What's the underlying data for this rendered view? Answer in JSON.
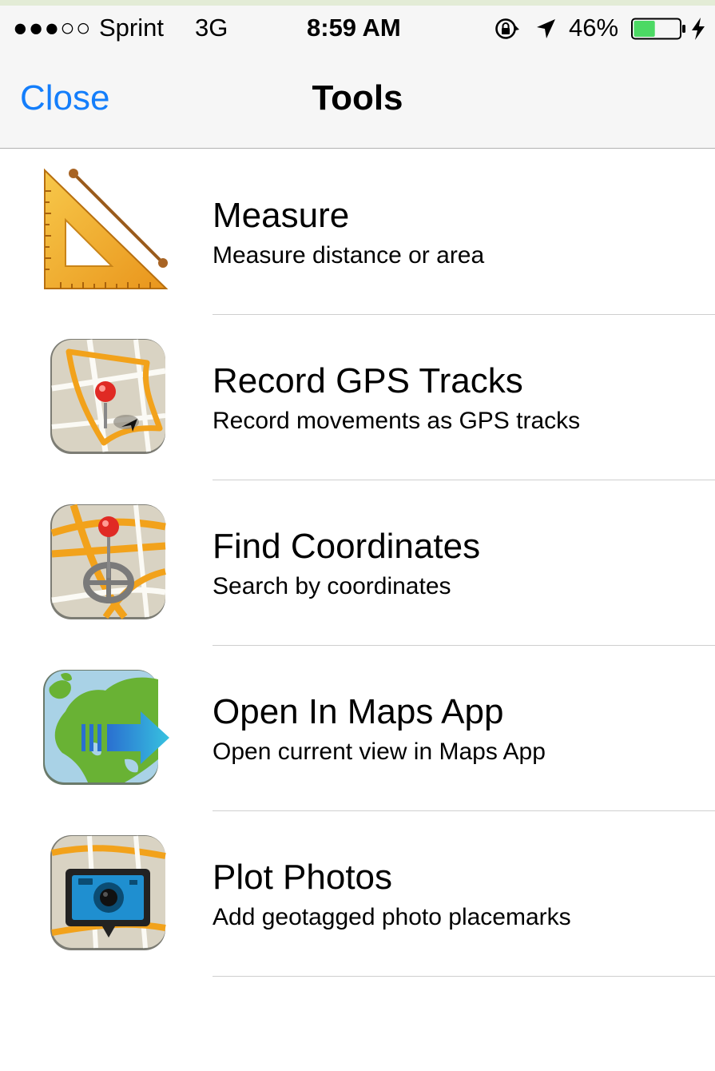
{
  "status_bar": {
    "signal": "●●●○○",
    "carrier": "Sprint",
    "network": "3G",
    "time": "8:59 AM",
    "battery_percent": "46%",
    "battery_level": 0.46,
    "icons": [
      "rotation-lock-icon",
      "location-arrow-icon",
      "battery-icon",
      "charging-bolt-icon"
    ]
  },
  "nav": {
    "close_label": "Close",
    "title": "Tools"
  },
  "colors": {
    "accent": "#147efb",
    "battery_fill": "#4cd964",
    "separator": "#cfcfcf"
  },
  "tools": [
    {
      "icon": "ruler-triangle-icon",
      "title": "Measure",
      "subtitle": "Measure distance or area"
    },
    {
      "icon": "gps-track-map-icon",
      "title": "Record GPS Tracks",
      "subtitle": "Record movements as GPS tracks"
    },
    {
      "icon": "coordinates-crosshair-map-icon",
      "title": "Find Coordinates",
      "subtitle": "Search by coordinates"
    },
    {
      "icon": "europe-map-arrow-icon",
      "title": "Open In Maps App",
      "subtitle": "Open current view in Maps App"
    },
    {
      "icon": "camera-map-icon",
      "title": "Plot Photos",
      "subtitle": "Add geotagged photo placemarks"
    }
  ]
}
